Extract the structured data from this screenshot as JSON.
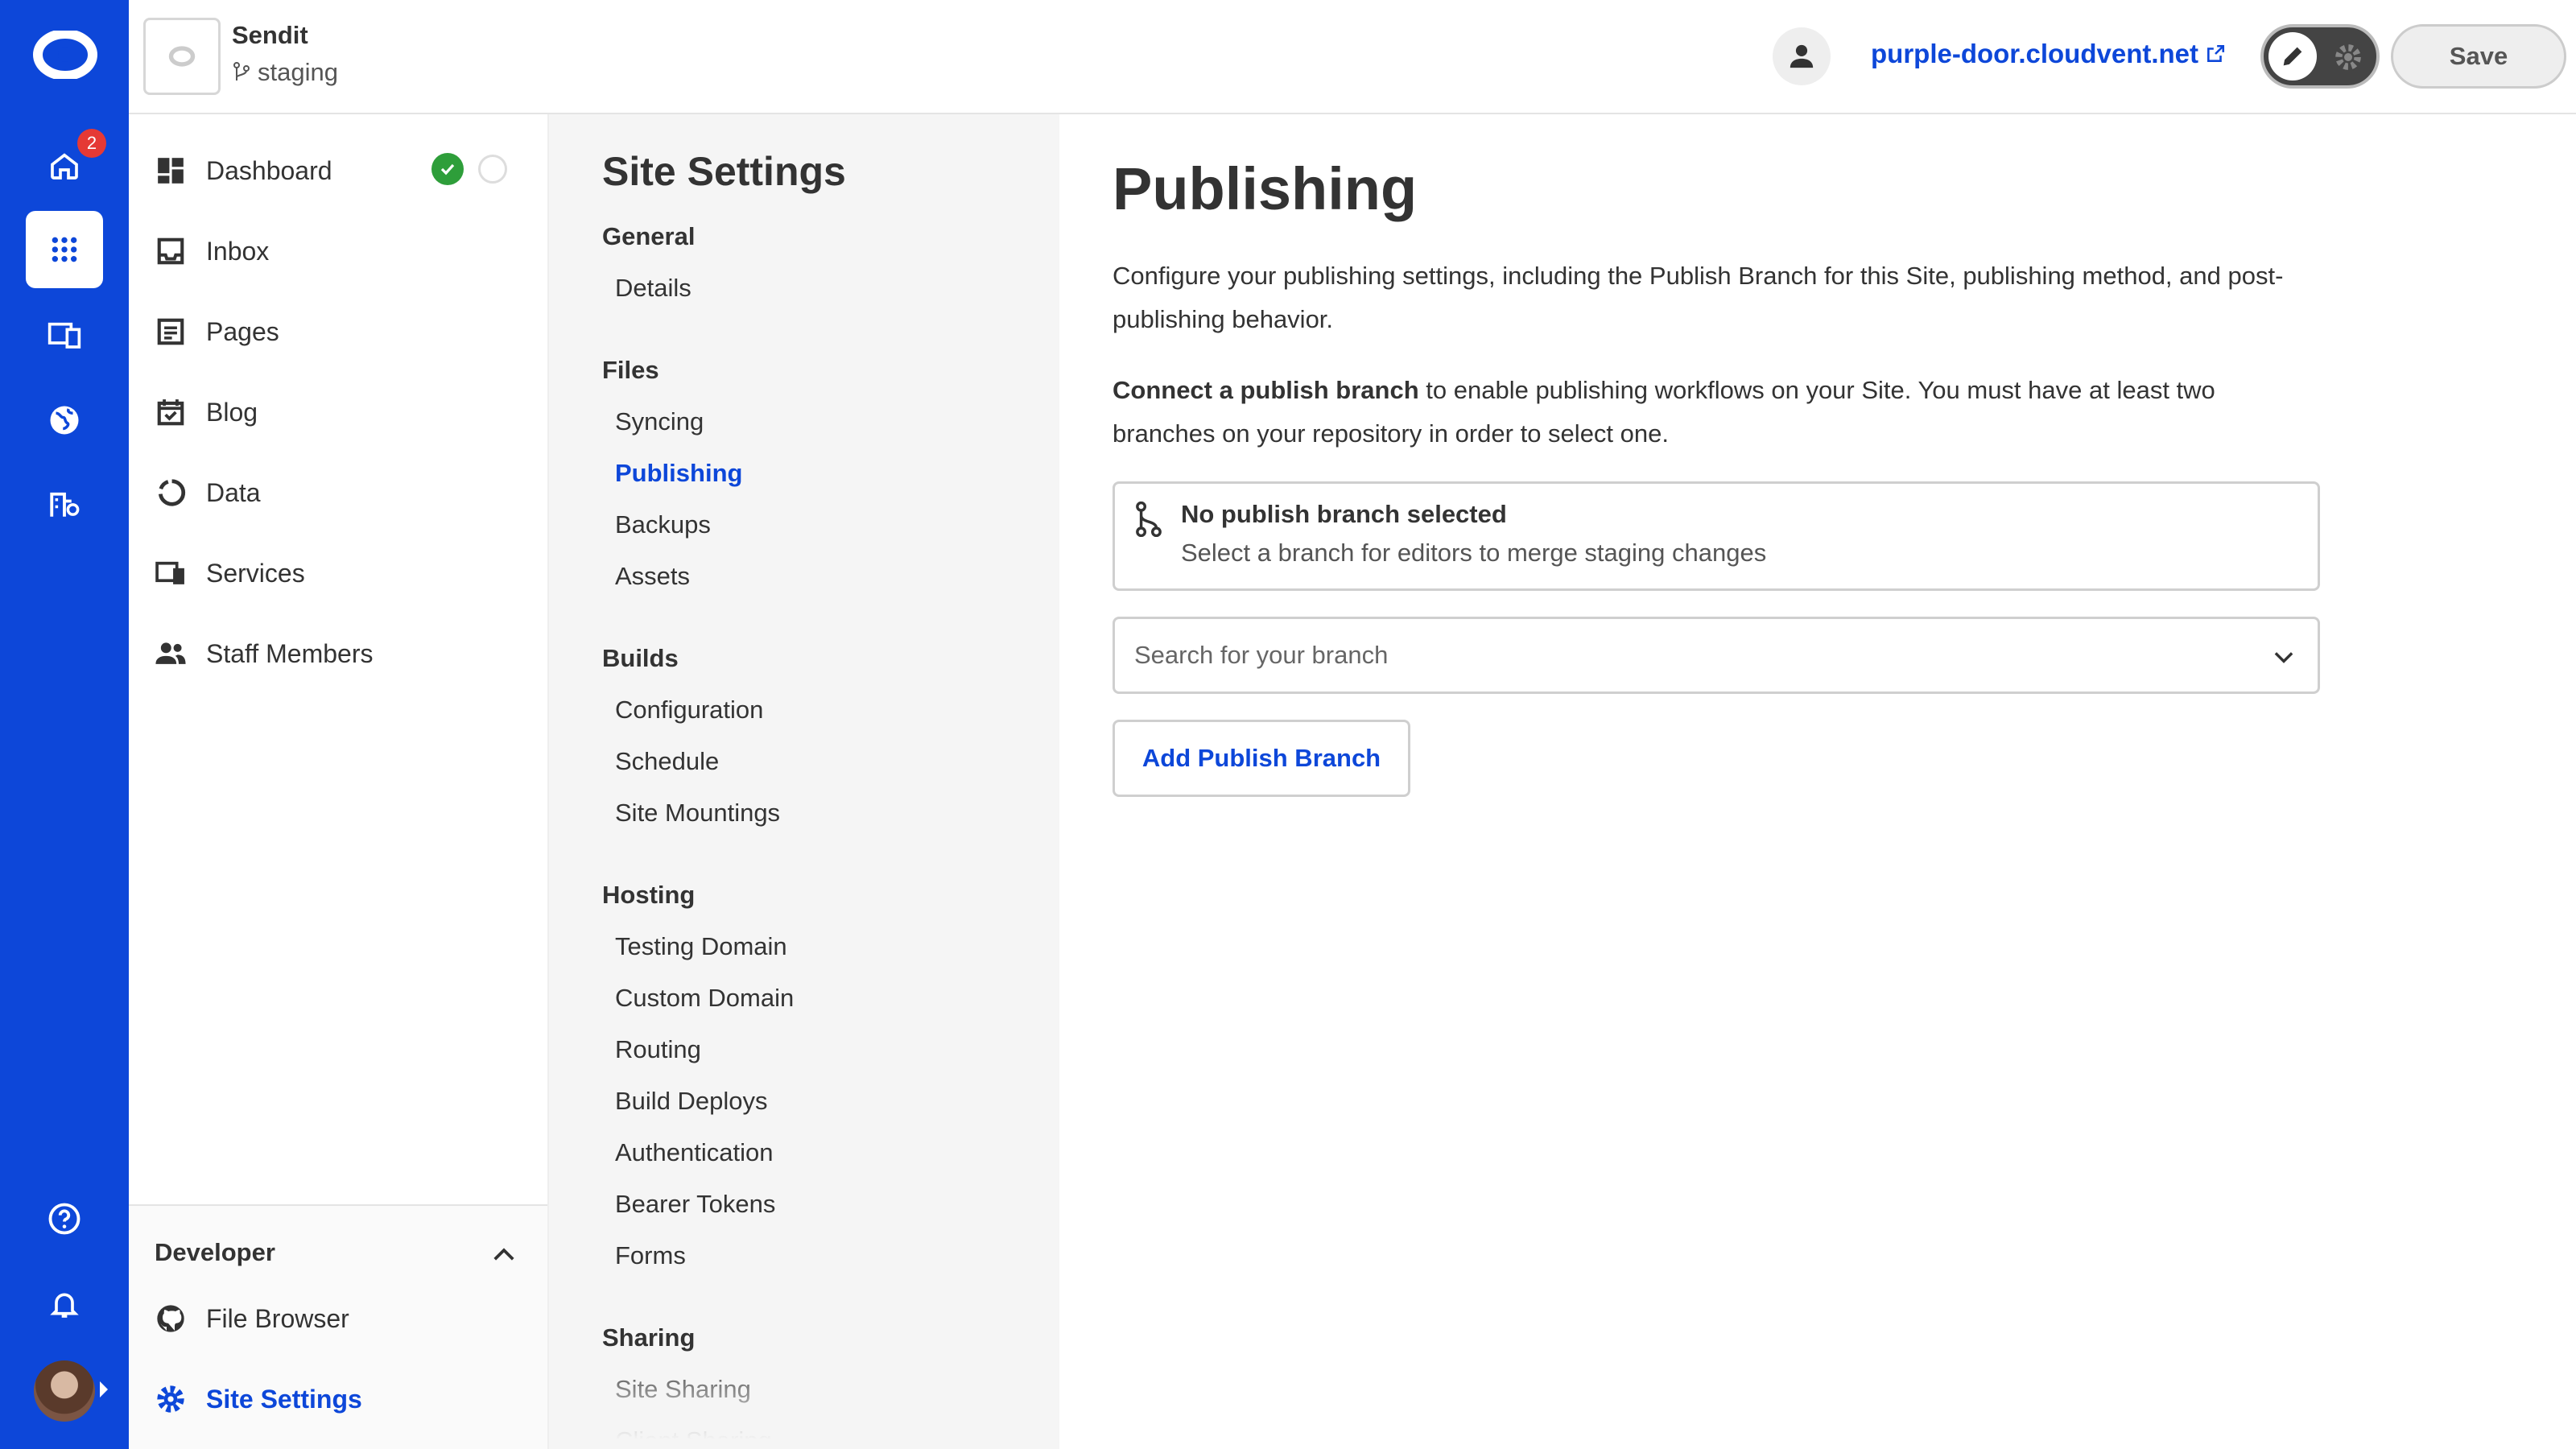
{
  "rail": {
    "notification_count": "2",
    "items": [
      "home-icon",
      "apps-icon",
      "devices-icon",
      "globe-icon",
      "organization-icon",
      "help-icon",
      "bell-icon"
    ]
  },
  "header": {
    "site_name": "Sendit",
    "branch": "staging",
    "domain": "purple-door.cloudvent.net",
    "save_label": "Save"
  },
  "nav": {
    "items": [
      {
        "label": "Dashboard",
        "icon": "dashboard-icon"
      },
      {
        "label": "Inbox",
        "icon": "inbox-icon"
      },
      {
        "label": "Pages",
        "icon": "pages-icon"
      },
      {
        "label": "Blog",
        "icon": "blog-calendar-icon"
      },
      {
        "label": "Data",
        "icon": "data-icon"
      },
      {
        "label": "Services",
        "icon": "services-icon"
      },
      {
        "label": "Staff Members",
        "icon": "people-icon"
      }
    ],
    "developer": {
      "title": "Developer",
      "items": [
        {
          "label": "File Browser",
          "icon": "github-icon"
        },
        {
          "label": "Site Settings",
          "icon": "gear-icon"
        }
      ]
    }
  },
  "subnav": {
    "title": "Site Settings",
    "groups": [
      {
        "title": "General",
        "links": [
          "Details"
        ]
      },
      {
        "title": "Files",
        "links": [
          "Syncing",
          "Publishing",
          "Backups",
          "Assets"
        ]
      },
      {
        "title": "Builds",
        "links": [
          "Configuration",
          "Schedule",
          "Site Mountings"
        ]
      },
      {
        "title": "Hosting",
        "links": [
          "Testing Domain",
          "Custom Domain",
          "Routing",
          "Build Deploys",
          "Authentication",
          "Bearer Tokens",
          "Forms"
        ]
      },
      {
        "title": "Sharing",
        "links": [
          "Site Sharing",
          "Client Sharing"
        ]
      }
    ],
    "active": "Publishing"
  },
  "main": {
    "title": "Publishing",
    "description": "Configure your publishing settings, including the Publish Branch for this Site, publishing method, and post-publishing behavior.",
    "connect_bold": "Connect a publish branch",
    "connect_rest": " to enable publishing workflows on your Site. You must have at least two branches on your repository in order to select one.",
    "notice_title": "No publish branch selected",
    "notice_sub": "Select a branch for editors to merge staging changes",
    "search_placeholder": "Search for your branch",
    "add_button": "Add Publish Branch"
  },
  "colors": {
    "brand": "#0d47d9",
    "success": "#2e9e3a",
    "badge": "#e53935"
  }
}
